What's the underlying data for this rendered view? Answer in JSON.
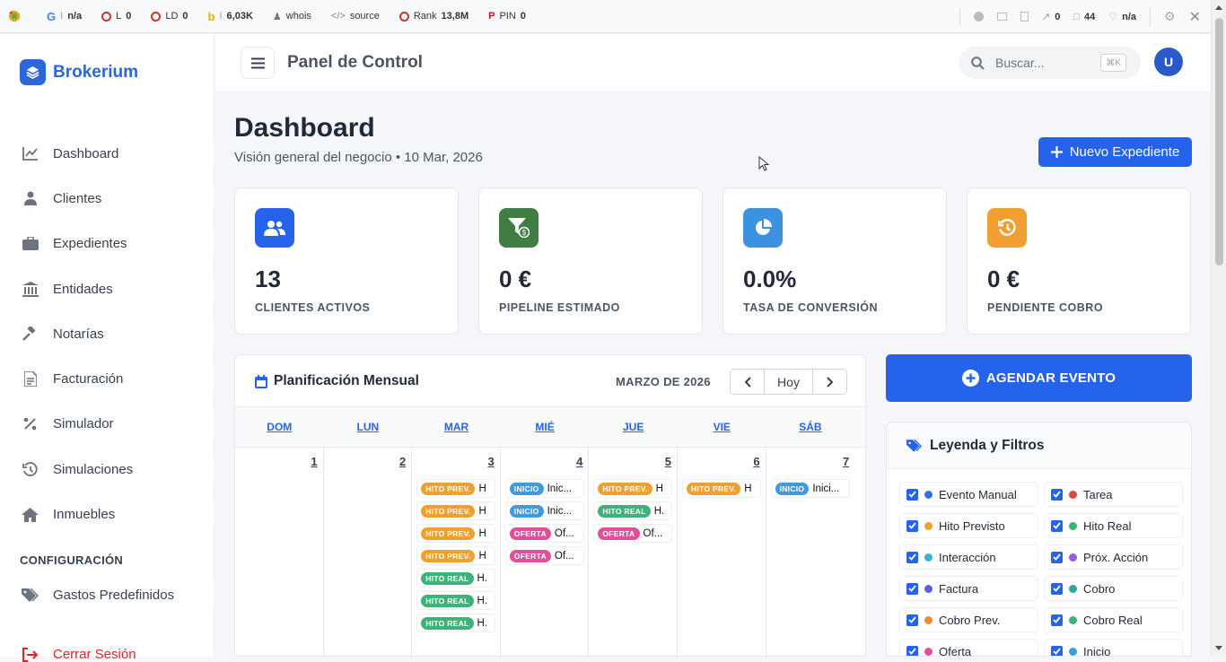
{
  "seo_bar": {
    "google": "n/a",
    "l": "0",
    "ld": "0",
    "bing": "6,03K",
    "whois": "whois",
    "source": "source",
    "rank_label": "Rank",
    "rank": "13,8M",
    "pin_label": "PIN",
    "pin": "0",
    "links": "0",
    "pages": "44",
    "trust": "n/a"
  },
  "sidebar": {
    "brand": "Brokerium",
    "items": [
      {
        "label": "Dashboard",
        "icon": "chart-line-icon"
      },
      {
        "label": "Clientes",
        "icon": "user-icon"
      },
      {
        "label": "Expedientes",
        "icon": "briefcase-icon"
      },
      {
        "label": "Entidades",
        "icon": "bank-icon"
      },
      {
        "label": "Notarías",
        "icon": "gavel-icon"
      },
      {
        "label": "Facturación",
        "icon": "invoice-icon"
      },
      {
        "label": "Simulador",
        "icon": "percent-icon"
      },
      {
        "label": "Simulaciones",
        "icon": "history-icon"
      },
      {
        "label": "Inmuebles",
        "icon": "home-icon"
      }
    ],
    "config_title": "CONFIGURACIÓN",
    "config_item": "Gastos Predefinidos",
    "logout": "Cerrar Sesión"
  },
  "header": {
    "title": "Panel de Control",
    "search_placeholder": "Buscar...",
    "shortcut": "⌘K",
    "avatar": "U"
  },
  "page": {
    "title": "Dashboard",
    "subtitle": "Visión general del negocio • 10 Mar, 2026",
    "new_button": "Nuevo Expediente"
  },
  "stats": [
    {
      "value": "13",
      "label": "CLIENTES ACTIVOS",
      "color": "#2563eb"
    },
    {
      "value": "0 €",
      "label": "PIPELINE ESTIMADO",
      "color": "#3f7d43"
    },
    {
      "value": "0.0%",
      "label": "TASA DE CONVERSIÓN",
      "color": "#3b93e0"
    },
    {
      "value": "0 €",
      "label": "PENDIENTE COBRO",
      "color": "#f0a030"
    }
  ],
  "calendar": {
    "title": "Planificación Mensual",
    "month": "MARZO DE 2026",
    "today": "Hoy",
    "weekdays": [
      "DOM",
      "LUN",
      "MAR",
      "MIÉ",
      "JUE",
      "VIE",
      "SÁB"
    ],
    "days": [
      {
        "num": "1",
        "events": []
      },
      {
        "num": "2",
        "events": []
      },
      {
        "num": "3",
        "events": [
          {
            "badge": "HITO PREV.",
            "text": "H",
            "color": "#f0a030"
          },
          {
            "badge": "HITO PREV.",
            "text": "H",
            "color": "#f0a030"
          },
          {
            "badge": "HITO PREV.",
            "text": "H",
            "color": "#f0a030"
          },
          {
            "badge": "HITO PREV.",
            "text": "H",
            "color": "#f0a030"
          },
          {
            "badge": "HITO REAL",
            "text": "H.",
            "color": "#3db37a"
          },
          {
            "badge": "HITO REAL",
            "text": "H.",
            "color": "#3db37a"
          },
          {
            "badge": "HITO REAL",
            "text": "H.",
            "color": "#3db37a"
          }
        ]
      },
      {
        "num": "4",
        "events": [
          {
            "badge": "INICIO",
            "text": "Inic...",
            "color": "#3f9be0"
          },
          {
            "badge": "INICIO",
            "text": "Inic...",
            "color": "#3f9be0"
          },
          {
            "badge": "OFERTA",
            "text": "Of...",
            "color": "#e0509a"
          },
          {
            "badge": "OFERTA",
            "text": "Of...",
            "color": "#e0509a"
          }
        ]
      },
      {
        "num": "5",
        "events": [
          {
            "badge": "HITO PREV.",
            "text": "H",
            "color": "#f0a030"
          },
          {
            "badge": "HITO REAL",
            "text": "H.",
            "color": "#3db37a"
          },
          {
            "badge": "OFERTA",
            "text": "Of...",
            "color": "#e0509a"
          }
        ]
      },
      {
        "num": "6",
        "events": [
          {
            "badge": "HITO PREV.",
            "text": "H",
            "color": "#f0a030"
          }
        ]
      },
      {
        "num": "7",
        "events": [
          {
            "badge": "INICIO",
            "text": "Inici...",
            "color": "#3f9be0"
          }
        ]
      }
    ]
  },
  "schedule_button": "AGENDAR EVENTO",
  "legend": {
    "title": "Leyenda y Filtros",
    "items": [
      {
        "label": "Evento Manual",
        "color": "#3b6fe0"
      },
      {
        "label": "Tarea",
        "color": "#e04848"
      },
      {
        "label": "Hito Previsto",
        "color": "#f0a030"
      },
      {
        "label": "Hito Real",
        "color": "#3db37a"
      },
      {
        "label": "Interacción",
        "color": "#3bb0d8"
      },
      {
        "label": "Próx. Acción",
        "color": "#9b59e0"
      },
      {
        "label": "Factura",
        "color": "#5b5fe0"
      },
      {
        "label": "Cobro",
        "color": "#2aa89a"
      },
      {
        "label": "Cobro Prev.",
        "color": "#f08c30"
      },
      {
        "label": "Cobro Real",
        "color": "#3db37a"
      },
      {
        "label": "Oferta",
        "color": "#e0509a"
      },
      {
        "label": "Inicio",
        "color": "#3f9be0"
      }
    ]
  }
}
